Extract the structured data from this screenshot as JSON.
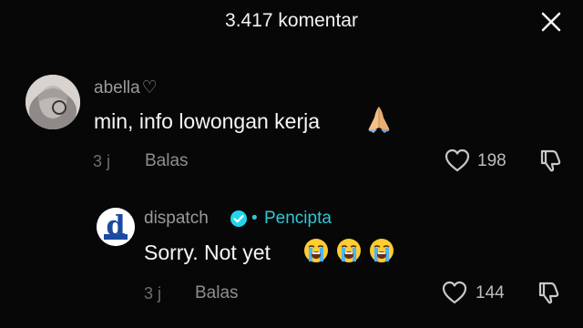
{
  "header": {
    "title": "3.417 komentar",
    "close_icon": "close-icon"
  },
  "comments": [
    {
      "username": "abella",
      "username_suffix": "♡",
      "avatar": "user-avatar-photo",
      "text": "min, info lowongan kerja",
      "emoji": [
        "folded-hands-emoji"
      ],
      "time": "3 j",
      "reply_label": "Balas",
      "likes": "198"
    },
    {
      "username": "dispatch",
      "verified": true,
      "separator": "•",
      "badge": "Pencipta",
      "avatar": "dispatch-logo-avatar",
      "text": "Sorry. Not yet",
      "emoji": [
        "loudly-crying-face-emoji",
        "loudly-crying-face-emoji",
        "loudly-crying-face-emoji"
      ],
      "time": "3 j",
      "reply_label": "Balas",
      "likes": "144"
    }
  ],
  "colors": {
    "background": "#070707",
    "text_primary": "#f5f5f5",
    "text_secondary": "#9a9a9a",
    "creator_accent": "#2fc7d6",
    "verified_blue": "#20d5ec"
  }
}
